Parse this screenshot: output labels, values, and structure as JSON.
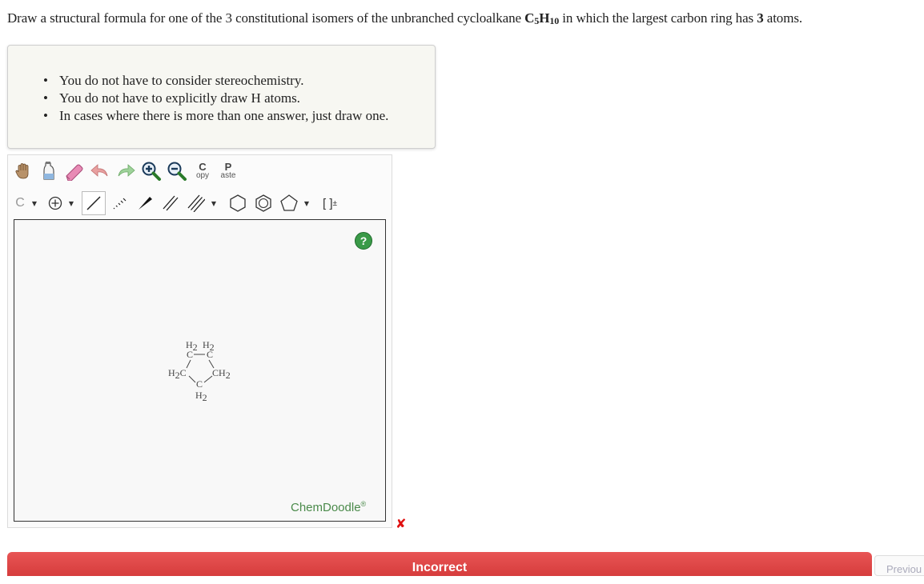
{
  "question": {
    "prefix": "Draw a structural formula for one of the 3 constitutional isomers of the unbranched cycloalkane ",
    "formula_c": "C",
    "formula_c_sub": "5",
    "formula_h": "H",
    "formula_h_sub": "10",
    "middle": " in which the largest carbon ring has ",
    "ring_size": "3",
    "suffix": " atoms."
  },
  "hints": [
    "You do not have to consider stereochemistry.",
    "You do not have to explicitly draw H atoms.",
    "In cases where there is more than one answer, just draw one."
  ],
  "toolbar": {
    "copy_big": "C",
    "copy_small": "opy",
    "paste_big": "P",
    "paste_small": "aste",
    "element_label": "C",
    "bracket_label": "[ ]",
    "bracket_sup": "±",
    "dropdown_glyph": "▼"
  },
  "canvas": {
    "help_label": "?",
    "brand": "ChemDoodle",
    "brand_mark": "®",
    "molecule": {
      "atom_top_left": "H",
      "atom_top_left_sub": "2",
      "atom_top_right": "H",
      "atom_top_right_sub": "2",
      "c_label": "C",
      "left_h": "H",
      "left_h_sub": "2",
      "left_c": "C",
      "right_c": "C",
      "right_h": "H",
      "right_h_sub": "2",
      "bottom_c": "C",
      "bottom_h": "H",
      "bottom_h_sub": "2"
    }
  },
  "status": {
    "mark": "✘",
    "result_label": "Incorrect",
    "previous_label": "Previou"
  },
  "colors": {
    "incorrect_red": "#d63c3c",
    "help_green": "#3a9a48",
    "brand_green": "#4a8a4a"
  }
}
